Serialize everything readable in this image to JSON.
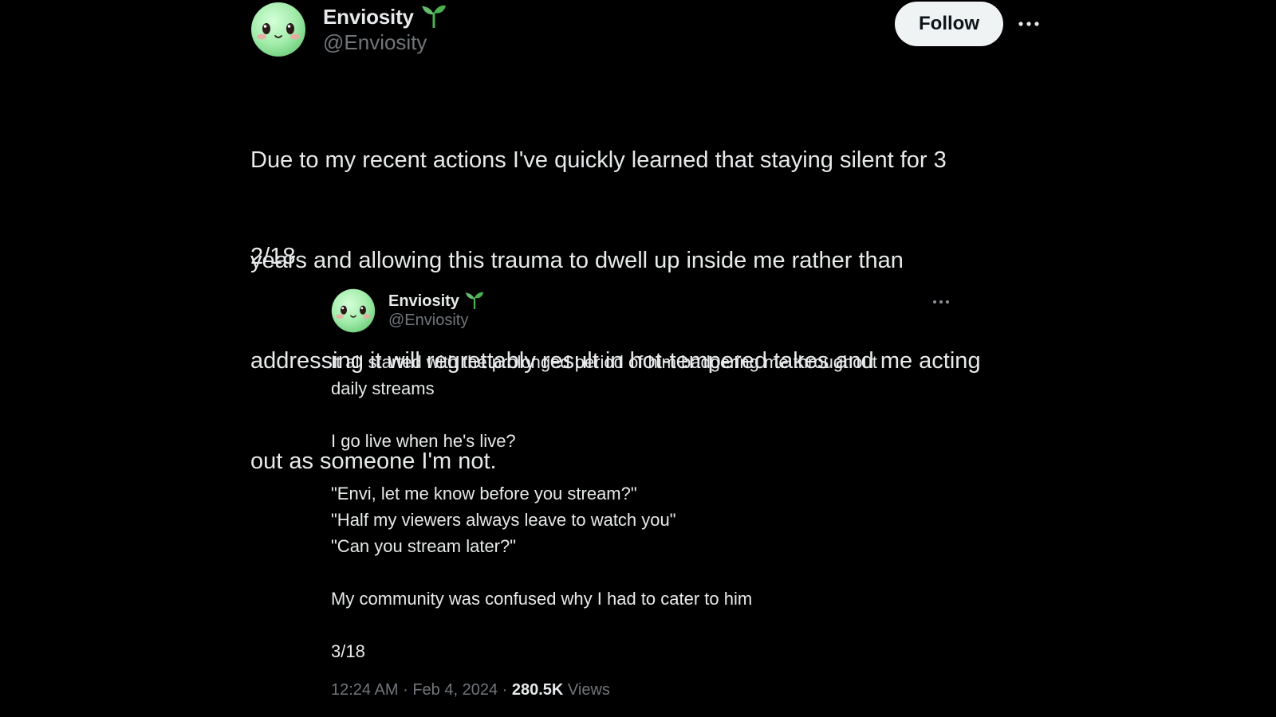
{
  "main_post": {
    "author_name": "Enviosity",
    "author_handle": "@Enviosity",
    "follow_label": "Follow",
    "text_lines": [
      "Due to my recent actions I've quickly learned that staying silent for 3",
      "years and allowing this trauma to dwell up inside me rather than",
      "addressing it will regrettably result in hot-tempered takes and me acting",
      "out as someone I'm not."
    ],
    "thread_count": "2/18",
    "icons": {
      "avatar": "green-face-avatar",
      "badge": "sprout-icon",
      "more": "more-dots-icon"
    }
  },
  "quoted_post": {
    "author_name": "Enviosity",
    "author_handle": "@Enviosity",
    "line_1": "It all started with the prolonged period of him badgering me throughout",
    "line_2": "daily streams",
    "line_3": "I go live when he's live?",
    "line_4": "\"Envi, let me know before you stream?\"",
    "line_5": "\"Half my viewers always leave to watch you\"",
    "line_6": "\"Can you stream later?\"",
    "line_7": "My community was confused why I had to cater to him",
    "thread_count": "3/18"
  },
  "meta": {
    "time": "12:24 AM",
    "separator": "·",
    "date": "Feb 4, 2024",
    "views_count": "280.5K",
    "views_label": "Views"
  },
  "colors": {
    "background": "#000000",
    "text": "#e7e9ea",
    "secondary_text": "#71767b",
    "follow_button": "#eff3f4",
    "avatar_green": "#a6f0b0",
    "badge_green": "#4caf50"
  }
}
